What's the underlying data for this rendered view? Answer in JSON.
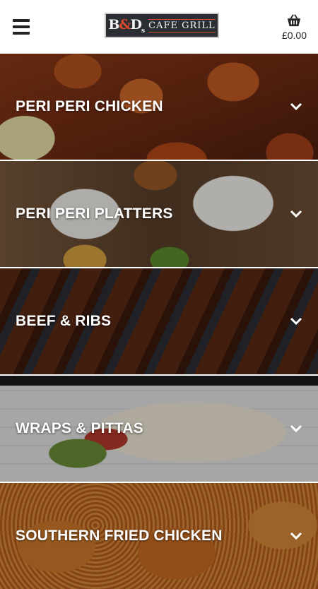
{
  "header": {
    "logo_mark_b": "B",
    "logo_mark_amp": "&",
    "logo_mark_d": "D",
    "logo_mark_s": "s",
    "logo_name": "CAFE GRILL",
    "cart_total": "£0.00"
  },
  "icons": {
    "menu": "hamburger-icon",
    "cart": "basket-icon",
    "expand": "chevron-down-icon"
  },
  "categories": [
    {
      "label": "PERI PERI CHICKEN"
    },
    {
      "label": "PERI PERI PLATTERS"
    },
    {
      "label": "BEEF & RIBS"
    },
    {
      "label": "WRAPS & PITTAS"
    },
    {
      "label": "SOUTHERN FRIED CHICKEN"
    }
  ],
  "colors": {
    "accent": "#e04a2e",
    "logo_bg": "#2b2f33",
    "text_on_image": "#ffffff"
  }
}
